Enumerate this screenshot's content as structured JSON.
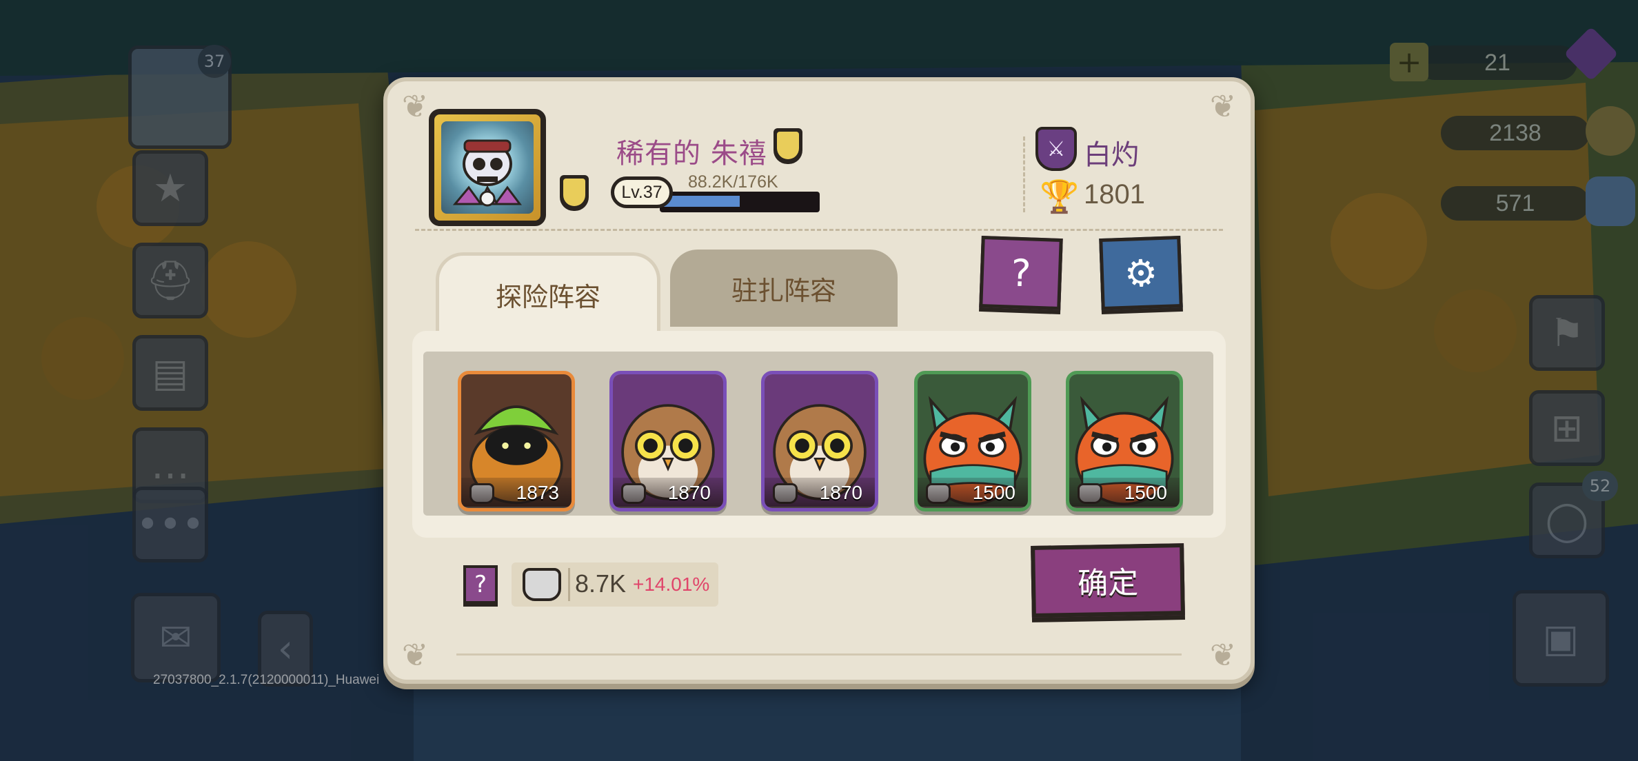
{
  "player": {
    "name": "稀有的 朱禧",
    "level": "Lv.37",
    "xp_text": "88.2K/176K",
    "xp_fraction": 0.5
  },
  "guild": {
    "name": "白灼",
    "trophies": "1801"
  },
  "tabs": [
    {
      "label": "探险阵容",
      "active": true
    },
    {
      "label": "驻扎阵容",
      "active": false
    }
  ],
  "buttons": {
    "help": "?",
    "settings_icon": "gear-icon",
    "confirm": "确定"
  },
  "heroes": [
    {
      "power": "1873",
      "rarity_color": "#e98a3a",
      "name_icon": "leaf-creature-icon"
    },
    {
      "power": "1870",
      "rarity_color": "#7a4fb8",
      "name_icon": "owl-icon"
    },
    {
      "power": "1870",
      "rarity_color": "#7a4fb8",
      "name_icon": "owl-icon"
    },
    {
      "power": "1500",
      "rarity_color": "#4f9a55",
      "name_icon": "fox-creature-icon"
    },
    {
      "power": "1500",
      "rarity_color": "#4f9a55",
      "name_icon": "fox-creature-icon"
    }
  ],
  "team_power": {
    "total": "8.7K",
    "bonus": "+14.01%"
  },
  "background": {
    "avatar_level": "37",
    "resources": [
      {
        "value": "21"
      },
      {
        "value": "2138"
      },
      {
        "value": "571"
      }
    ],
    "mail_badge": "52",
    "version": "27037800_2.1.7(2120000011)_Huawei"
  }
}
